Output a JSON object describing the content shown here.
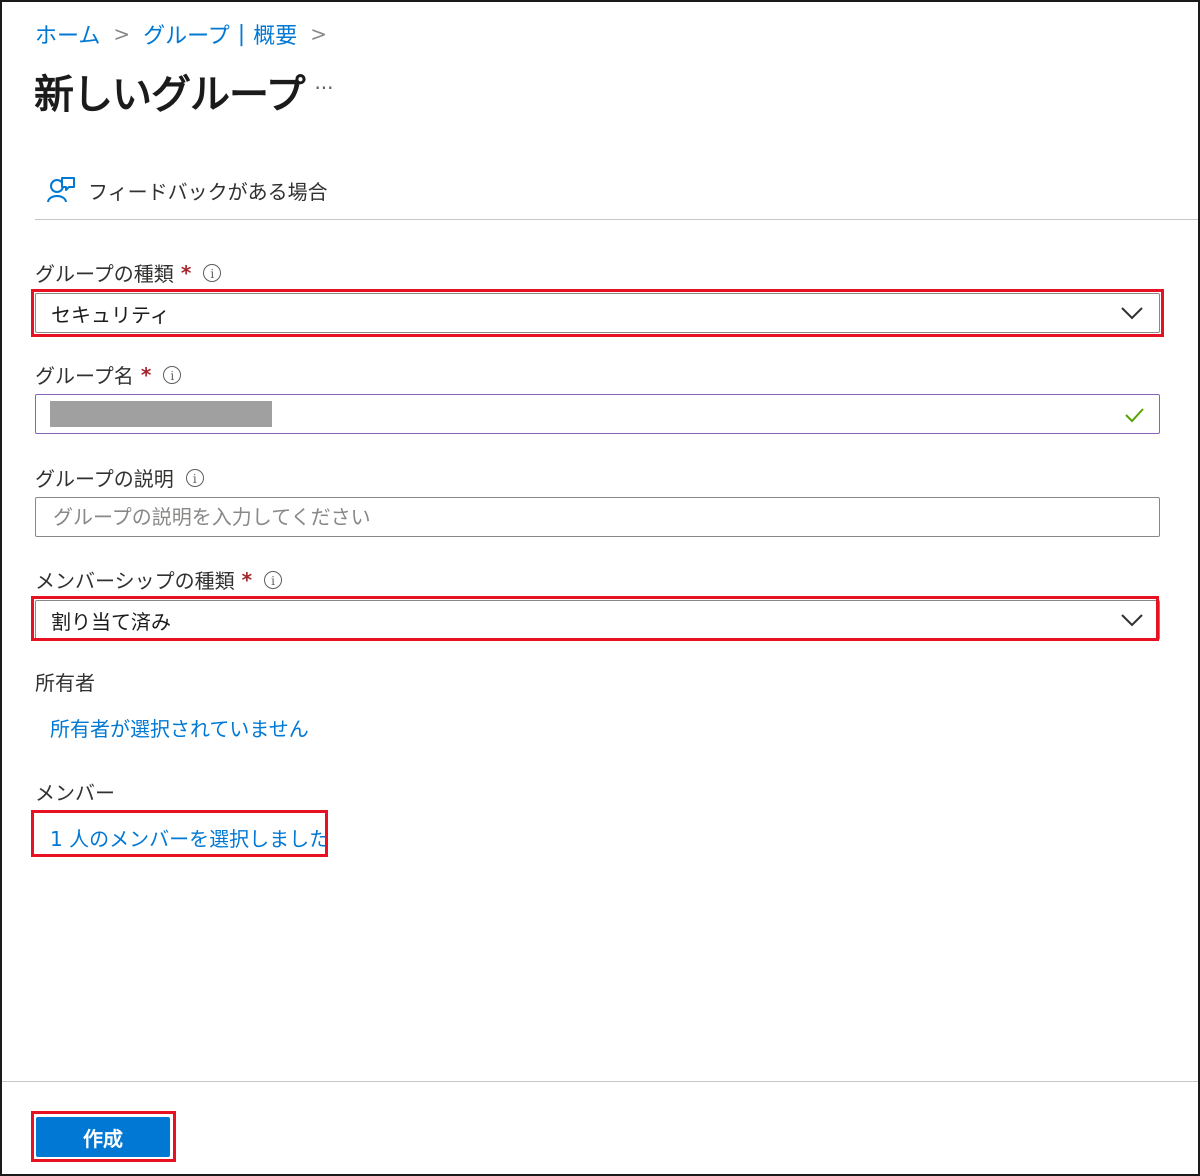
{
  "breadcrumb": {
    "home": "ホーム",
    "groups": "グループ",
    "pipe": "|",
    "overview": "概要",
    "separator": ">"
  },
  "page": {
    "title": "新しいグループ",
    "more": "···"
  },
  "feedback": {
    "label": "フィードバックがある場合",
    "icon": "feedback-person-icon"
  },
  "form": {
    "group_type": {
      "label": "グループの種類",
      "required_mark": "*",
      "info": "i",
      "value": "セキュリティ"
    },
    "group_name": {
      "label": "グループ名",
      "required_mark": "*",
      "info": "i",
      "valid": true
    },
    "group_description": {
      "label": "グループの説明",
      "info": "i",
      "placeholder": "グループの説明を入力してください"
    },
    "membership_type": {
      "label": "メンバーシップの種類",
      "required_mark": "*",
      "info": "i",
      "value": "割り当て済み"
    },
    "owners": {
      "label": "所有者",
      "link": "所有者が選択されていません"
    },
    "members": {
      "label": "メンバー",
      "link": "1 人のメンバーを選択しました"
    }
  },
  "actions": {
    "create": "作成"
  },
  "colors": {
    "accent": "#0078d4",
    "highlight": "#e81123",
    "required": "#a4262c",
    "valid": "#57a300",
    "focus_border": "#8764b8"
  }
}
